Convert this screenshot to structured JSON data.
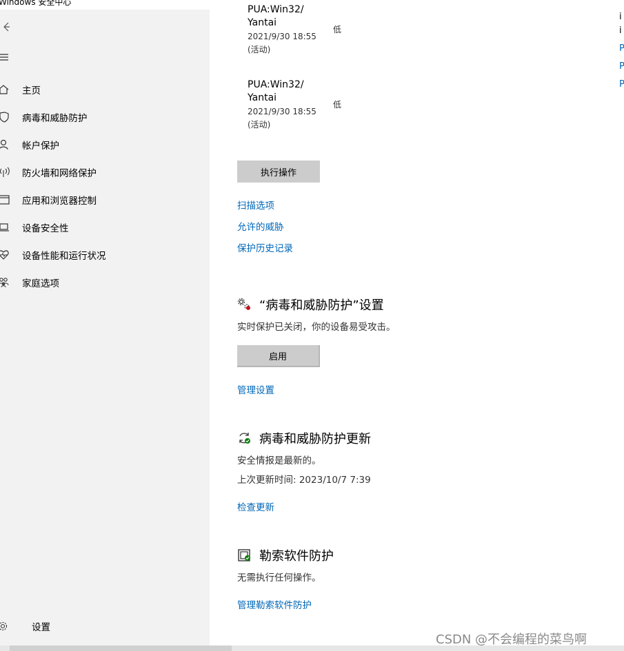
{
  "window": {
    "title": "Windows 安全中心"
  },
  "sidebar": {
    "items": [
      {
        "label": "主页",
        "icon": "home-icon"
      },
      {
        "label": "病毒和威胁防护",
        "icon": "shield-icon"
      },
      {
        "label": "帐户保护",
        "icon": "person-icon"
      },
      {
        "label": "防火墙和网络保护",
        "icon": "antenna-icon"
      },
      {
        "label": "应用和浏览器控制",
        "icon": "app-window-icon"
      },
      {
        "label": "设备安全性",
        "icon": "laptop-icon"
      },
      {
        "label": "设备性能和运行状况",
        "icon": "heart-pulse-icon"
      },
      {
        "label": "家庭选项",
        "icon": "family-icon"
      }
    ],
    "settings_label": "设置"
  },
  "threats": [
    {
      "name_line1": "PUA:Win32/",
      "name_line2": "Yantai",
      "time": "2021/9/30 18:55",
      "status": "(活动)",
      "severity": "低"
    },
    {
      "name_line1": "PUA:Win32/",
      "name_line2": "Yantai",
      "time": "2021/9/30 18:55",
      "status": "(活动)",
      "severity": "低"
    }
  ],
  "actions": {
    "execute_label": "执行操作"
  },
  "links": {
    "scan_options": "扫描选项",
    "allowed_threats": "允许的威胁",
    "protection_history": "保护历史记录"
  },
  "settings_section": {
    "title": "“病毒和威胁防护”设置",
    "description": "实时保护已关闭，你的设备易受攻击。",
    "enable_label": "启用",
    "manage_link": "管理设置"
  },
  "updates_section": {
    "title": "病毒和威胁防护更新",
    "status": "安全情报是最新的。",
    "last_update": "上次更新时间: 2023/10/7 7:39",
    "check_link": "检查更新"
  },
  "ransomware_section": {
    "title": "勒索软件防护",
    "status": "无需执行任何操作。",
    "manage_link": "管理勒索软件防护"
  },
  "right_panel": {
    "chars": [
      "i",
      "i",
      "P",
      "P",
      "P"
    ]
  },
  "watermark": "CSDN @不会编程的菜鸟啊",
  "colors": {
    "link": "#0067b8",
    "sidebar_bg": "#f2f2f2",
    "button_bg": "#cccccc",
    "ok_green": "#107c10"
  }
}
